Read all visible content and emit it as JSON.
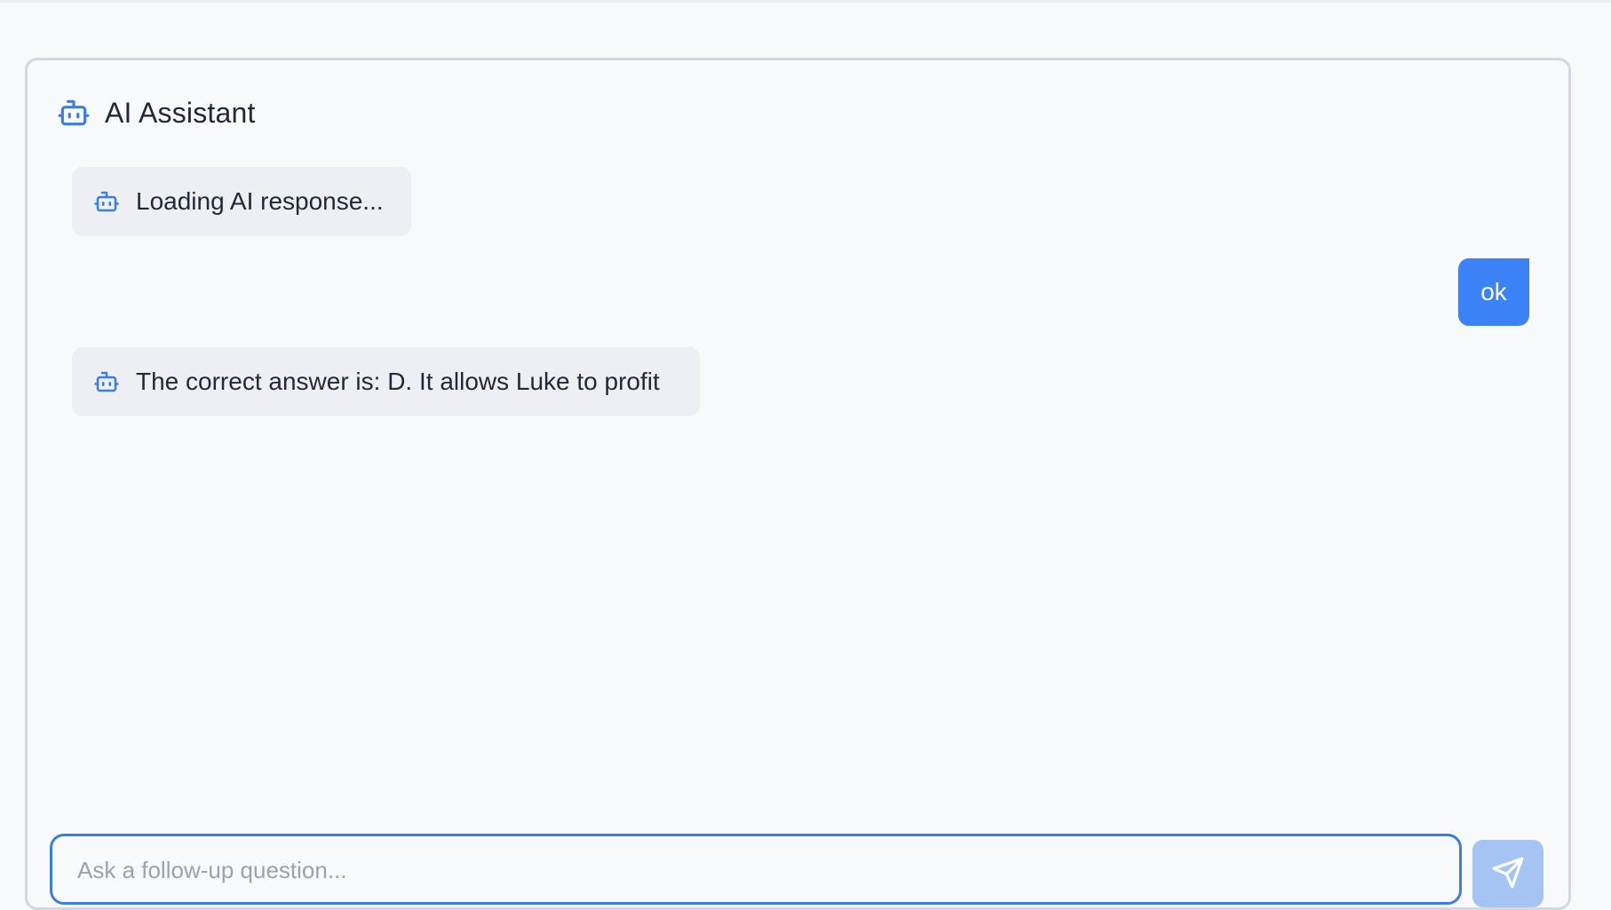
{
  "header": {
    "title": "AI Assistant",
    "icon": "bot-icon"
  },
  "messages": [
    {
      "role": "assistant",
      "text": "Loading AI response...",
      "icon": "bot-icon"
    },
    {
      "role": "user",
      "text": "ok"
    },
    {
      "role": "assistant",
      "text": "The correct answer is: D. It allows Luke to profit",
      "icon": "bot-icon"
    }
  ],
  "composer": {
    "placeholder": "Ask a follow-up question...",
    "value": "",
    "send_icon": "send-icon"
  },
  "colors": {
    "accent": "#3b7de4",
    "user_bubble": "#3b82f6",
    "ai_bubble": "#edeff2",
    "send_disabled": "#a5c4f4"
  }
}
